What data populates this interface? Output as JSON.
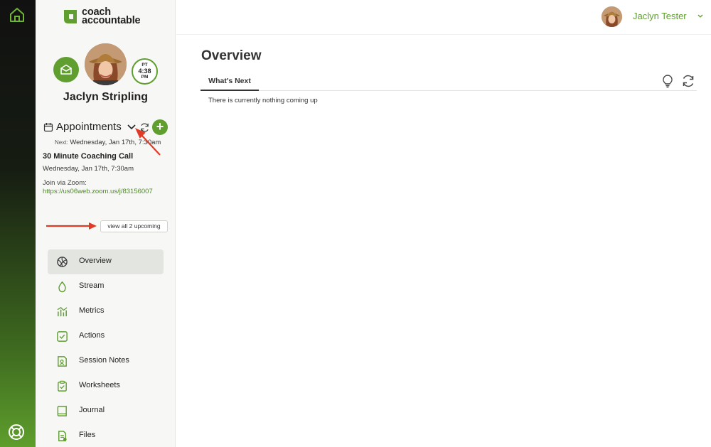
{
  "brand": {
    "logo_line1": "coach",
    "logo_line2": "accountable",
    "accent": "#5f9e2f"
  },
  "rail": {
    "top_icon": "home-icon",
    "bottom_icon": "lifebuoy-icon"
  },
  "client": {
    "name": "Jaclyn Stripling",
    "timezone": "PT",
    "time": "4:38",
    "ampm": "PM"
  },
  "appointments": {
    "title": "Appointments",
    "next_label": "Next:",
    "next_value": "Wednesday, Jan 17th, 7:30am",
    "item_title": "30 Minute Coaching Call",
    "item_date": "Wednesday, Jan 17th, 7:30am",
    "zoom_label": "Join via Zoom:",
    "zoom_link": "https://us06web.zoom.us/j/83156007",
    "view_all": "view all 2 upcoming"
  },
  "nav": [
    {
      "label": "Overview",
      "icon": "overview-icon",
      "active": true
    },
    {
      "label": "Stream",
      "icon": "drop-icon"
    },
    {
      "label": "Metrics",
      "icon": "metrics-icon"
    },
    {
      "label": "Actions",
      "icon": "checkbox-icon"
    },
    {
      "label": "Session Notes",
      "icon": "notes-icon"
    },
    {
      "label": "Worksheets",
      "icon": "clipboard-icon"
    },
    {
      "label": "Journal",
      "icon": "book-icon"
    },
    {
      "label": "Files",
      "icon": "files-icon"
    }
  ],
  "header": {
    "user_name": "Jaclyn Tester"
  },
  "main": {
    "title": "Overview",
    "tab": "What's Next",
    "empty_message": "There is currently nothing coming up"
  }
}
